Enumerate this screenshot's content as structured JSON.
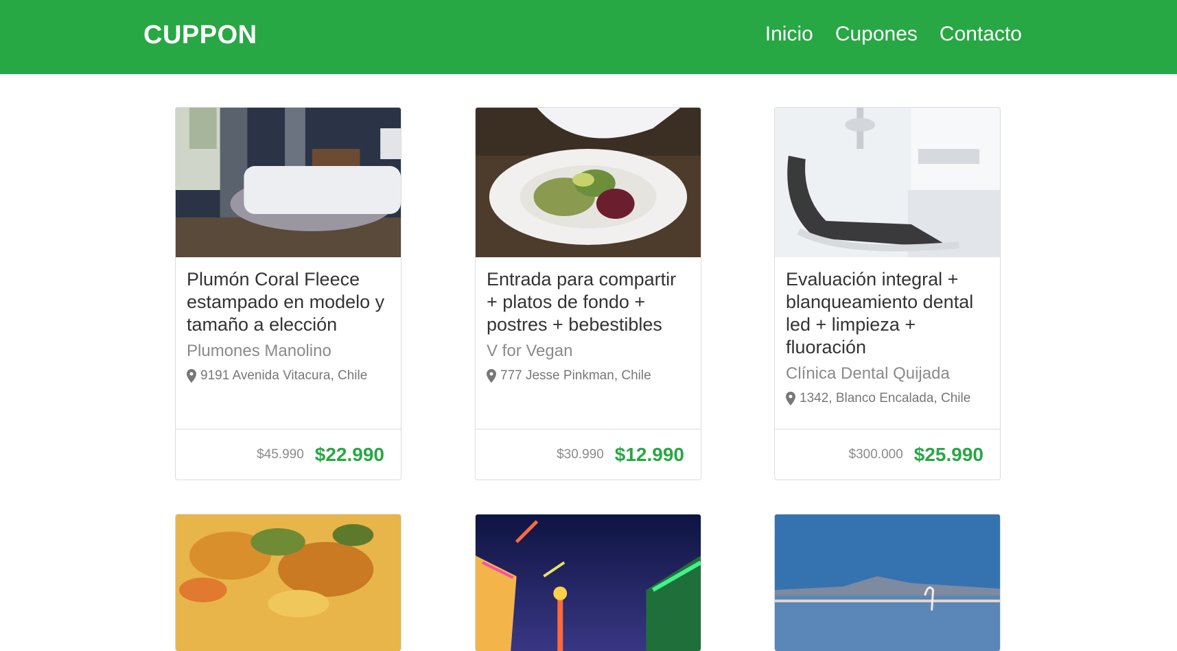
{
  "nav": {
    "brand": "CUPPON",
    "links": [
      "Inicio",
      "Cupones",
      "Contacto"
    ]
  },
  "coupons": [
    {
      "title": "Plumón Coral Fleece estampado en modelo y tamaño a elección",
      "merchant": "Plumones Manolino",
      "address": "9191 Avenida Vitacura, Chile",
      "old_price": "$45.990",
      "new_price": "$22.990",
      "image": "bedroom-photo"
    },
    {
      "title": "Entrada para compartir + platos de fondo + postres + bebestibles",
      "merchant": "V for Vegan",
      "address": "777 Jesse Pinkman, Chile",
      "old_price": "$30.990",
      "new_price": "$12.990",
      "image": "vegan-dish-photo"
    },
    {
      "title": "Evaluación integral + blanqueamiento dental led + limpieza + fluoración",
      "merchant": "Clínica Dental Quijada",
      "address": "1342, Blanco Encalada, Chile",
      "old_price": "$300.000",
      "new_price": "$25.990",
      "image": "dental-clinic-photo"
    },
    {
      "image": "food-bowl-photo"
    },
    {
      "image": "amusement-park-photo"
    },
    {
      "image": "salt-flat-lake-photo"
    }
  ],
  "colors": {
    "brand_green": "#28a745",
    "border": "#dcdcdc"
  },
  "icons": {
    "address": "map-pin-icon"
  }
}
